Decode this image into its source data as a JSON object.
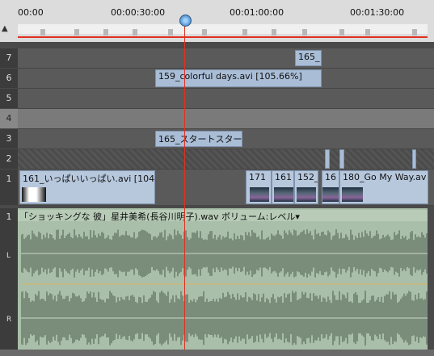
{
  "ruler": {
    "timecodes": [
      "00:00",
      "00:00:30:00",
      "00:01:00:00",
      "00:01:30:00"
    ]
  },
  "tracks": [
    {
      "num": "7"
    },
    {
      "num": "6"
    },
    {
      "num": "5"
    },
    {
      "num": "4"
    },
    {
      "num": "3"
    },
    {
      "num": "2"
    },
    {
      "num": "1"
    }
  ],
  "clips": {
    "t7": "165_",
    "t6": "159_colorful days.avi [105.66%]",
    "t3": "165_スタートスター.",
    "t1a": "161_いっぱいいっぱい.avi [104.",
    "t1b": "171",
    "t1c": "161",
    "t1d": "152_",
    "t1e": "16",
    "t1f": "180_Go My Way.av"
  },
  "audio": {
    "num": "1",
    "title": "「ショッキングな 彼」星井美希(長谷川明子).wav ボリューム:レベル▾",
    "left_label": "L",
    "right_label": "R"
  },
  "colors": {
    "playhead": "#e03020",
    "clip": "#a9bdd6",
    "audio": "#a9bfa9"
  }
}
